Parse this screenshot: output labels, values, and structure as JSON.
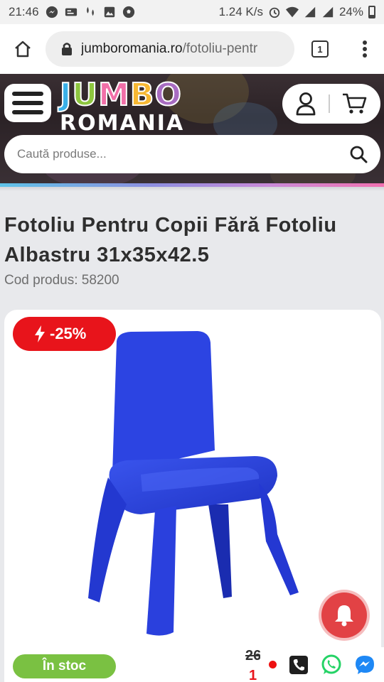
{
  "status_bar": {
    "time": "21:46",
    "speed": "1.24 K/s",
    "battery": "24%"
  },
  "browser": {
    "url_domain": "jumboromania.ro",
    "url_path": "/fotoliu-pentr",
    "tab_count": "1"
  },
  "site": {
    "logo_top": "JUMBO",
    "logo_bottom": "ROMANIA",
    "search_placeholder": "Caută produse..."
  },
  "product": {
    "title": "Fotoliu Pentru Copii Fără Fotoliu Albastru 31x35x42.5",
    "code": "Cod produs: 58200",
    "discount": "-25%",
    "stock": "În stoc",
    "old_price": "26",
    "new_price": "1"
  },
  "colors": {
    "brand_red": "#e8141b",
    "stock_green": "#7ac142",
    "chair_blue": "#2b3fd8",
    "whatsapp_green": "#25d366",
    "messenger_blue": "#1e88f5"
  }
}
